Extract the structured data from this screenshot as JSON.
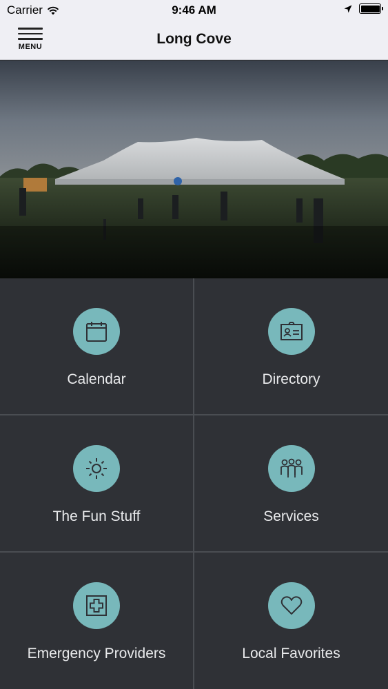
{
  "status_bar": {
    "carrier": "Carrier",
    "time": "9:46 AM"
  },
  "nav": {
    "menu_label": "MENU",
    "title": "Long Cove"
  },
  "tiles": [
    {
      "label": "Calendar",
      "icon": "calendar-icon"
    },
    {
      "label": "Directory",
      "icon": "id-card-icon"
    },
    {
      "label": "The Fun Stuff",
      "icon": "sun-icon"
    },
    {
      "label": "Services",
      "icon": "people-group-icon"
    },
    {
      "label": "Emergency Providers",
      "icon": "medical-cross-icon"
    },
    {
      "label": "Local Favorites",
      "icon": "heart-icon"
    }
  ],
  "colors": {
    "accent": "#78b8bb",
    "tile_bg": "#2f3136",
    "nav_bg": "#efeff4"
  }
}
